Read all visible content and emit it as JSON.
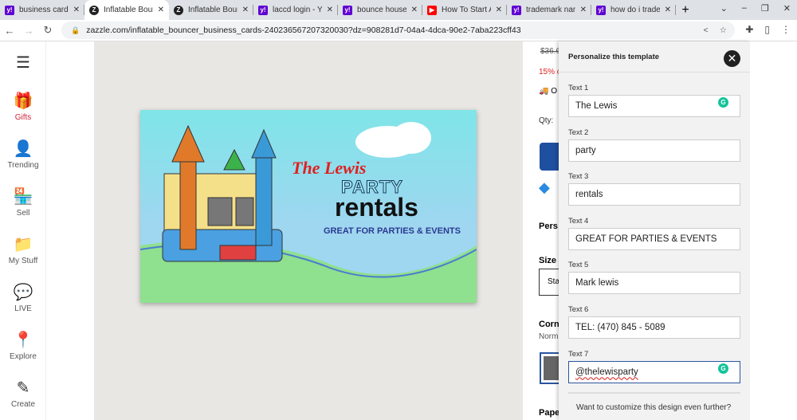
{
  "tabs": [
    {
      "title": "business cards",
      "icon": "yahoo",
      "active": false
    },
    {
      "title": "Inflatable Bouncer",
      "icon": "zazzle",
      "active": true
    },
    {
      "title": "Inflatable Bouncer",
      "icon": "zazzle",
      "active": false
    },
    {
      "title": "laccd login - Yahoo",
      "icon": "yahoo",
      "active": false
    },
    {
      "title": "bounce house",
      "icon": "yahoo",
      "active": false
    },
    {
      "title": "How To Start A",
      "icon": "youtube",
      "active": false
    },
    {
      "title": "trademark name",
      "icon": "yahoo",
      "active": false
    },
    {
      "title": "how do i trademark",
      "icon": "yahoo",
      "active": false
    }
  ],
  "url": "zazzle.com/inflatable_bouncer_business_cards-240236567207320030?dz=908281d7-04a4-4dca-90e2-7aba223cff43",
  "sidebar": [
    "Gifts",
    "Trending",
    "Sell",
    "My Stuff",
    "LIVE",
    "Explore",
    "Create"
  ],
  "card": {
    "line1": "The Lewis",
    "line2": "PARTY",
    "line3": "rentals",
    "line4": "GREAT FOR PARTIES & EVENTS"
  },
  "product": {
    "price": "$36.6",
    "discount": "15% o",
    "ship": "O",
    "qty": "Qty:",
    "personalize": "Pers",
    "size": "Size",
    "size_value": "Sta",
    "corners": "Corn",
    "corners_value": "Norm",
    "paper": "Pape"
  },
  "panel": {
    "title": "Personalize this template",
    "more": "Want to customize this design even further?",
    "fields": [
      {
        "label": "Text 1",
        "value": "The Lewis"
      },
      {
        "label": "Text 2",
        "value": "party"
      },
      {
        "label": "Text 3",
        "value": "rentals"
      },
      {
        "label": "Text 4",
        "value": "GREAT FOR PARTIES & EVENTS"
      },
      {
        "label": "Text 5",
        "value": "Mark lewis"
      },
      {
        "label": "Text 6",
        "value": "TEL: (470) 845 - 5089"
      },
      {
        "label": "Text 7",
        "value": "@thelewisparty"
      }
    ]
  }
}
